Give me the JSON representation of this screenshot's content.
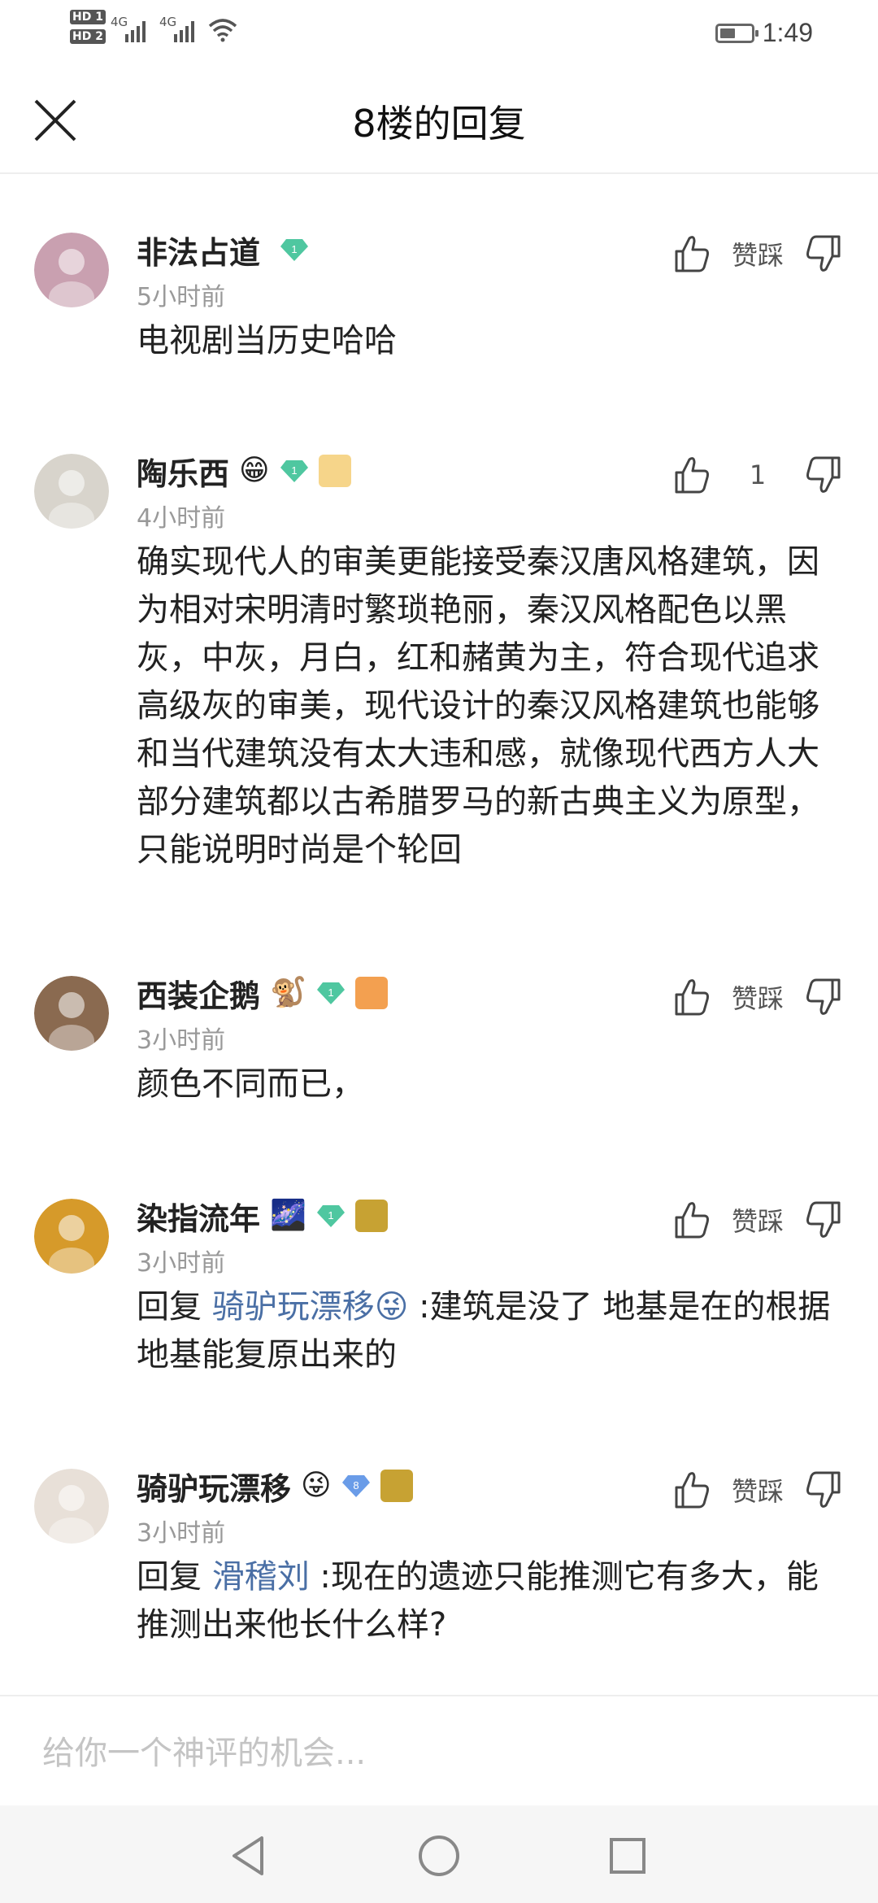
{
  "status_bar": {
    "sim1": "HD 1",
    "sim2": "HD 2",
    "network1": "4G",
    "network2": "4G",
    "time": "1:49",
    "battery_level": 0.5
  },
  "header": {
    "title": "8楼的回复",
    "close_icon": "close-icon"
  },
  "comments": [
    {
      "username": "非法占道",
      "emoji": "",
      "level": "1",
      "time": "5小时前",
      "vote_label": "赞踩",
      "reply_prefix": "",
      "reply_to": "",
      "text": "电视剧当历史哈哈",
      "avatar_color": "#c9a0b0"
    },
    {
      "username": "陶乐西",
      "emoji": "😁",
      "level": "1",
      "time": "4小时前",
      "vote_label": "1",
      "reply_prefix": "",
      "reply_to": "",
      "text": "确实现代人的审美更能接受秦汉唐风格建筑，因为相对宋明清时繁琐艳丽，秦汉风格配色以黑灰，中灰，月白，红和赭黄为主，符合现代追求高级灰的审美，现代设计的秦汉风格建筑也能够和当代建筑没有太大违和感，就像现代西方人大部分建筑都以古希腊罗马的新古典主义为原型，只能说明时尚是个轮回",
      "avatar_color": "#d8d4cc"
    },
    {
      "username": "西装企鹅",
      "emoji": "🐒",
      "level": "1",
      "time": "3小时前",
      "vote_label": "赞踩",
      "reply_prefix": "",
      "reply_to": "",
      "text": "颜色不同而已，",
      "avatar_color": "#8a6a50"
    },
    {
      "username": "染指流年",
      "emoji": "🌌",
      "level": "1",
      "time": "3小时前",
      "vote_label": "赞踩",
      "reply_prefix": "回复 ",
      "reply_to": "骑驴玩漂移😜",
      "text": " :建筑是没了 地基是在的根据地基能复原出来的",
      "avatar_color": "#d69a2a"
    },
    {
      "username": "骑驴玩漂移",
      "emoji": "😜",
      "level": "8",
      "time": "3小时前",
      "vote_label": "赞踩",
      "reply_prefix": "回复 ",
      "reply_to": "滑稽刘",
      "text": " :现在的遗迹只能推测它有多大，能推测出来他长什么样?",
      "avatar_color": "#e8e0d8"
    }
  ],
  "input": {
    "placeholder": "给你一个神评的机会..."
  },
  "nav": {
    "back": "back-icon",
    "home": "home-icon",
    "recents": "recents-icon"
  }
}
